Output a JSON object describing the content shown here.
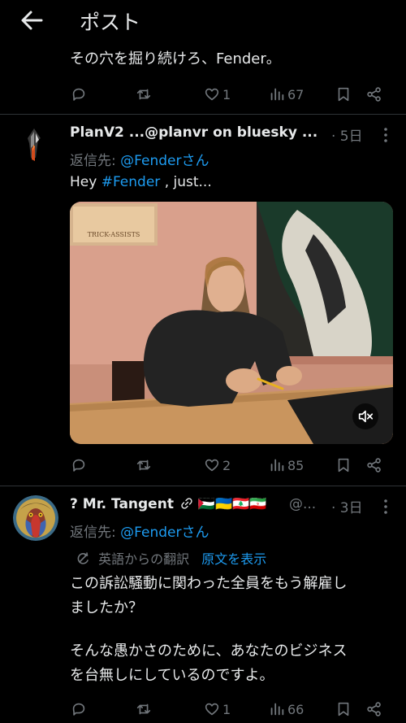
{
  "header": {
    "title": "ポスト"
  },
  "post0": {
    "text_tail": "その穴を掘り続けろ、Fender。",
    "actions": {
      "likes": "1",
      "views": "67"
    }
  },
  "post1": {
    "display_name": "PlanV2 ...@planvr on bluesky ...",
    "time": "· 5日",
    "reply_prefix": "返信先: ",
    "reply_handle": "@Fenderさん",
    "text_pre": "Hey ",
    "text_hashtag": "#Fender",
    "text_post": " , just...",
    "media": {
      "sign_text": "TRICK-ASSISTS"
    },
    "actions": {
      "likes": "2",
      "views": "85"
    }
  },
  "post2": {
    "display_name": "? Mr. Tangent",
    "flags": "🇵🇸🇺🇦🇱🇧🇮🇷",
    "handle": "@...",
    "time": "· 3日",
    "reply_prefix": "返信先: ",
    "reply_handle": "@Fenderさん",
    "translated_from": "英語からの翻訳",
    "show_original": "原文を表示",
    "lines": [
      "この訴訟騒動に関わった全員をもう解雇し",
      "ましたか？",
      "そんな愚かさのために、あなたのビジネス",
      "を台無しにしているのですよ。"
    ],
    "actions": {
      "likes": "1",
      "views": "66"
    }
  }
}
